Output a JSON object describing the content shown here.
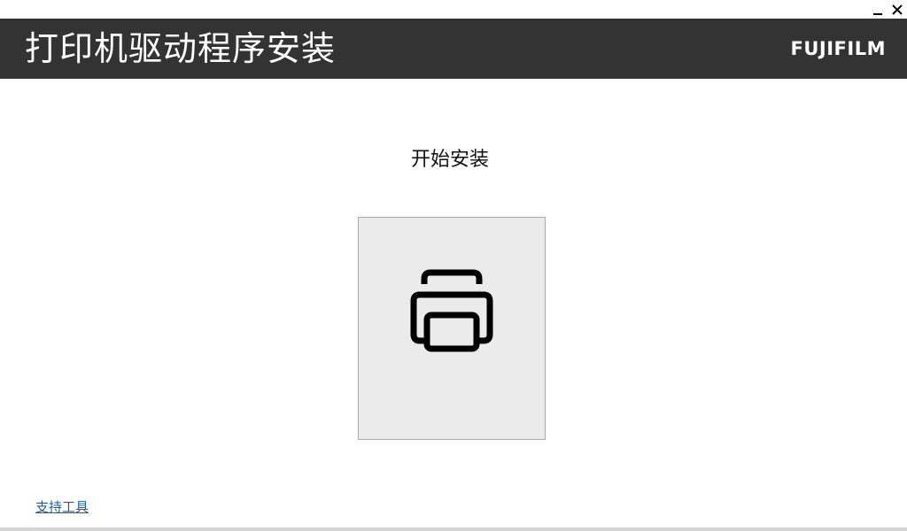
{
  "window": {
    "minimize_icon": "minimize-icon",
    "close_icon": "close-icon"
  },
  "header": {
    "title": "打印机驱动程序安装",
    "brand": "FUJIFILM",
    "background_color": "#333333"
  },
  "main": {
    "heading": "开始安装",
    "tile": {
      "icon": "printer-icon"
    }
  },
  "footer": {
    "support_link": "支持工具",
    "link_color": "#1a5fa5"
  }
}
